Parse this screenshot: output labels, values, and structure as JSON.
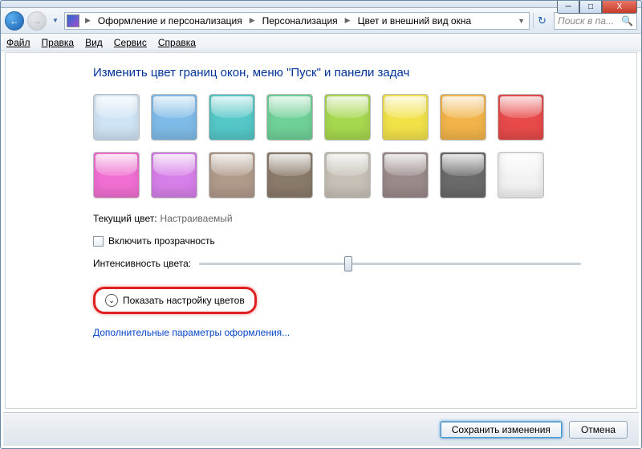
{
  "window": {
    "min": "─",
    "max": "□",
    "close": "X"
  },
  "breadcrumbs": {
    "items": [
      "Оформление и персонализация",
      "Персонализация",
      "Цвет и внешний вид окна"
    ]
  },
  "search": {
    "placeholder": "Поиск в па..."
  },
  "menu": {
    "file": "Файл",
    "edit": "Правка",
    "view": "Вид",
    "tools": "Сервис",
    "help": "Справка"
  },
  "heading": "Изменить цвет границ окон, меню \"Пуск\" и панели задач",
  "swatches": [
    "#cfe4f5",
    "#7fbbe8",
    "#55c7c7",
    "#6fd197",
    "#a6d84f",
    "#f2e24a",
    "#f2b44a",
    "#e84a4a",
    "#f06fd1",
    "#d67fe8",
    "#b09a8a",
    "#8a7a6a",
    "#c6c0b6",
    "#9a8a8a",
    "#6a6a6a",
    "#f2f2f2"
  ],
  "current": {
    "label": "Текущий цвет:",
    "value": "Настраиваемый"
  },
  "transparency": {
    "label": "Включить прозрачность"
  },
  "intensity": {
    "label": "Интенсивность цвета:"
  },
  "expander": {
    "label": "Показать настройку цветов"
  },
  "advanced_link": "Дополнительные параметры оформления...",
  "buttons": {
    "save": "Сохранить изменения",
    "cancel": "Отмена"
  }
}
